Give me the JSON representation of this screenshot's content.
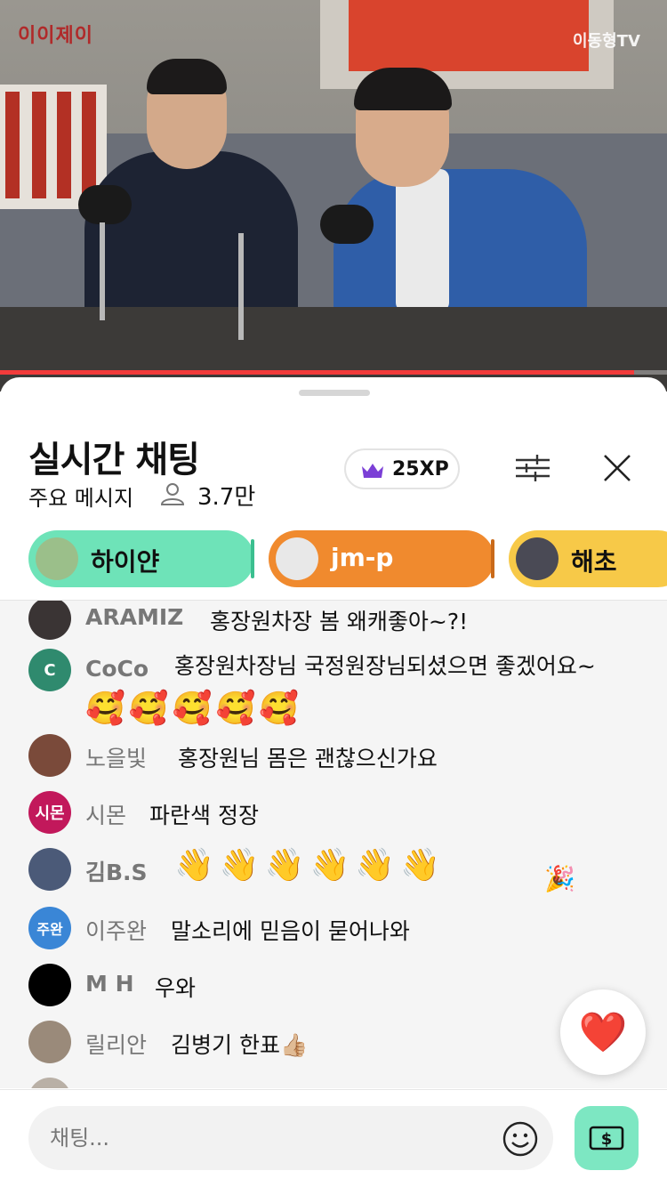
{
  "video": {
    "channel_logo_left": "이이제이",
    "channel_logo_right": "이동형TV",
    "progress": 0.95,
    "progress_color": "#f23b3b"
  },
  "header": {
    "title": "실시간 채팅",
    "subtitle": "주요 메시지",
    "viewer_count": "3.7만",
    "xp_label": "25XP",
    "crown_color": "#7b3fd6"
  },
  "chips": [
    {
      "label": "하이얀",
      "bg": "#6ee3b8",
      "text_color": "#111111",
      "bar_color": "#3bbf8f",
      "avatar_color": "#9bbf8a"
    },
    {
      "label": "jm-p",
      "bg": "#f08a2e",
      "text_color": "#ffffff",
      "bar_color": "#c96a1a",
      "avatar_color": "#e8e8e8"
    },
    {
      "label": "해초",
      "bg": "#f7c948",
      "text_color": "#111111",
      "bar_color": "#d9a925",
      "avatar_color": "#4a4a55"
    }
  ],
  "messages": [
    {
      "name": "ARAMIZ",
      "text": "홍장원차장 봄 왜캐좋아~?!",
      "avatar_text": "",
      "avatar_color": "#3a3434"
    },
    {
      "name": "CoCo",
      "text": "홍장원차장님 국정원장님되셨으면 좋겠어요~",
      "emoji": "🥰🥰🥰🥰🥰",
      "avatar_text": "C",
      "avatar_color": "#2f8a6e"
    },
    {
      "name": "노을빛",
      "text": "홍장원님 몸은 괜찮으신가요",
      "avatar_text": "",
      "avatar_color": "#7a4a3a"
    },
    {
      "name": "시몬",
      "text": "파란색 정장",
      "avatar_text": "시몬",
      "avatar_color": "#c2185b"
    },
    {
      "name": "김B.S",
      "text": "👋👋👋👋👋👋",
      "avatar_text": "",
      "avatar_color": "#4b5a78"
    },
    {
      "name": "이주완",
      "text": "말소리에 믿음이 묻어나와",
      "avatar_text": "주완",
      "avatar_color": "#3a86d6"
    },
    {
      "name": "M H",
      "text": "우와",
      "avatar_text": "",
      "avatar_color": "#000000"
    },
    {
      "name": "릴리안",
      "text": "김병기 한표👍🏼",
      "avatar_text": "",
      "avatar_color": "#9a8a7a"
    }
  ],
  "reaction_button": {
    "icon": "heart-icon",
    "emoji": "❤️"
  },
  "composer": {
    "placeholder": "채팅...",
    "money_color": "#7de7c2"
  }
}
